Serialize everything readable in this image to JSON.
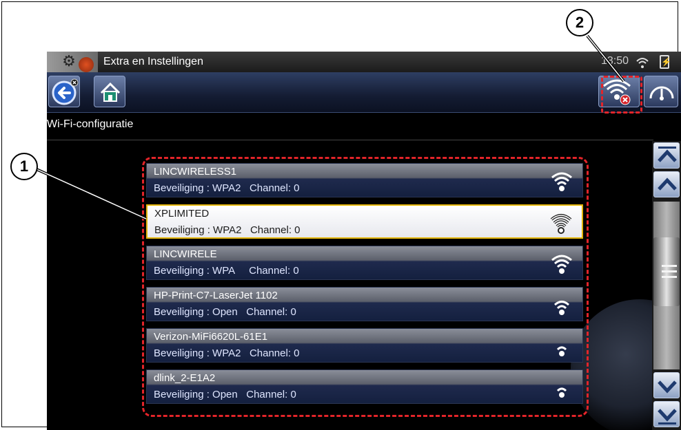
{
  "header": {
    "title": "Extra en Instellingen",
    "clock": "13:50"
  },
  "page": {
    "section_title": "Wi-Fi-configuratie"
  },
  "networks": [
    {
      "name": "LINCWIRELESS1",
      "security_line": "Beveiliging : WPA2   Channel: 0",
      "signal_bars": 4,
      "selected": false
    },
    {
      "name": "XPLIMITED",
      "security_line": "Beveiliging : WPA2   Channel: 0",
      "signal_bars": 4,
      "selected": true
    },
    {
      "name": "LINCWIRELE",
      "security_line": "Beveiliging : WPA     Channel: 0",
      "signal_bars": 4,
      "selected": false
    },
    {
      "name": "HP-Print-C7-LaserJet 1102",
      "security_line": "Beveiliging : Open   Channel: 0",
      "signal_bars": 3,
      "selected": false
    },
    {
      "name": "Verizon-MiFi6620L-61E1",
      "security_line": "Beveiliging : WPA2   Channel: 0",
      "signal_bars": 2,
      "selected": false
    },
    {
      "name": "dlink_2-E1A2",
      "security_line": "Beveiliging : Open   Channel: 0",
      "signal_bars": 2,
      "selected": false
    }
  ],
  "callouts": {
    "one": "1",
    "two": "2"
  },
  "icons": {
    "back": "back-arrow-icon",
    "home": "home-icon",
    "wifi_off": "wifi-disconnect-icon",
    "gauge": "gauge-icon",
    "scroll_top": "double-chevron-up-icon",
    "scroll_up": "chevron-up-icon",
    "scroll_down": "chevron-down-icon",
    "scroll_bottom": "double-chevron-down-icon"
  },
  "colors": {
    "annotation_red": "#e32429",
    "selection_border": "#e3b400",
    "toolbar_blue": "#1b2644"
  }
}
